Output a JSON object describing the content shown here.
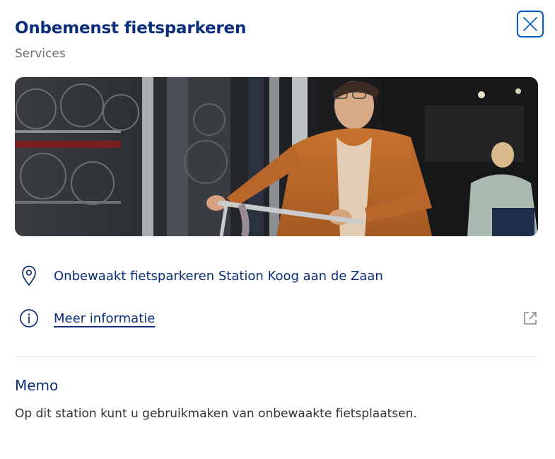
{
  "header": {
    "title": "Onbemenst fietsparkeren",
    "subtitle": "Services"
  },
  "close_button": {
    "icon": "close-icon",
    "color": "#0b62c4"
  },
  "hero_image": {
    "description_icon": "photo"
  },
  "details": {
    "location": {
      "icon": "map-pin-icon",
      "text": "Onbewaakt fietsparkeren Station Koog aan de Zaan"
    },
    "info": {
      "icon": "info-icon",
      "link_text": "Meer informatie",
      "external_icon": "external-link-icon"
    }
  },
  "memo": {
    "heading": "Memo",
    "text": "Op dit station kunt u gebruikmaken van onbewaakte fietsplaatsen."
  },
  "colors": {
    "primary": "#0b2f7a",
    "accent": "#0b62c4",
    "muted": "#6f6f6f"
  }
}
